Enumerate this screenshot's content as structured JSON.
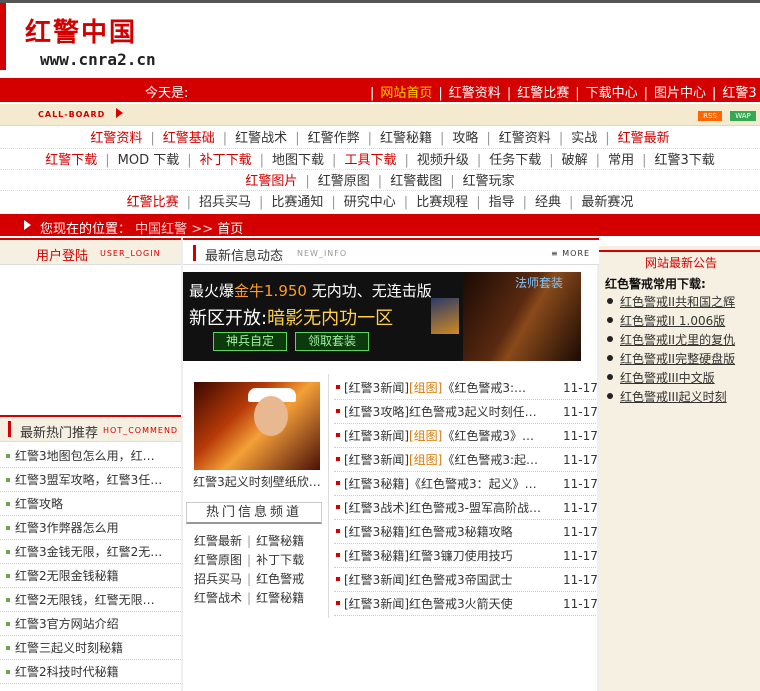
{
  "header": {
    "logo_title": "红警中国",
    "logo_url": "www.cnra2.cn"
  },
  "navbar": {
    "today_label": "今天是:",
    "items": [
      {
        "label": "网站首页",
        "active": true
      },
      {
        "label": "红警资料"
      },
      {
        "label": "红警比赛"
      },
      {
        "label": "下载中心"
      },
      {
        "label": "图片中心"
      },
      {
        "label": "红警3"
      }
    ]
  },
  "callboard": {
    "label": "CALL-BOARD",
    "rss": "RSS",
    "wap": "WAP"
  },
  "categories": {
    "row1": [
      "红警资料",
      "红警基础",
      "红警战术",
      "红警作弊",
      "红警秘籍",
      "攻略",
      "红警资料",
      "实战",
      "红警最新"
    ],
    "row1_red": [
      true,
      true,
      false,
      false,
      false,
      false,
      false,
      false,
      true
    ],
    "row2": [
      "红警下载",
      "MOD 下载",
      "补丁下载",
      "地图下载",
      "工具下载",
      "视频升级",
      "任务下载",
      "破解",
      "常用",
      "红警3下载"
    ],
    "row2_red": [
      true,
      false,
      true,
      false,
      true,
      false,
      false,
      false,
      false,
      false
    ],
    "row3": [
      "红警图片",
      "红警原图",
      "红警截图",
      "红警玩家"
    ],
    "row3_red": [
      true,
      false,
      false,
      false
    ],
    "row4": [
      "红警比赛",
      "招兵买马",
      "比赛通知",
      "研究中心",
      "比赛规程",
      "指导",
      "经典",
      "最新赛况"
    ],
    "row4_red": [
      true,
      false,
      false,
      false,
      false,
      false,
      false,
      false
    ]
  },
  "location": {
    "prefix": "您现在的位置：",
    "path1": "中国红警",
    "sep": ">>",
    "path2": "首页"
  },
  "left": {
    "login_title": "用户登陆",
    "login_en": "USER_LOGIN",
    "hot_title": "最新热门推荐",
    "hot_en": "HOT_COMMEND",
    "hot_items": [
      "红警3地图包怎么用，红…",
      "红警3盟军攻略，红警3任…",
      "红警攻略",
      "红警3作弊器怎么用",
      "红警3金钱无限，红警2无…",
      "红警2无限金钱秘籍",
      "红警2无限钱，红警无限…",
      "红警3官方网站介绍",
      "红警三起义时刻秘籍",
      "红警2科技时代秘籍"
    ]
  },
  "middle": {
    "title": "最新信息动态",
    "en": "NEW_INFO",
    "more": "MORE",
    "banner": {
      "line1_a": "最火爆",
      "line1_gold": "金牛1.950",
      "line1_b": " 无内功、无连击版",
      "line2_a": "新区开放:",
      "line2_gold": "暗影无内功一区",
      "btn1": "神兵自定",
      "btn2": "领取套装",
      "badge": "法师套装"
    },
    "photo_caption": "红警3起义时刻壁纸欣…",
    "channel_title": "热门信息频道",
    "channels": [
      [
        "红警最新",
        "红警秘籍"
      ],
      [
        "红警原图",
        "补丁下载"
      ],
      [
        "招兵买马",
        "红色警戒"
      ],
      [
        "红警战术",
        "红警秘籍"
      ]
    ],
    "news": [
      {
        "cat": "[红警3新闻]",
        "tag": "[组图]",
        "text": "《红色警戒3:…",
        "date": "11-17"
      },
      {
        "cat": "[红警3攻略]",
        "tag": "",
        "text": "红色警戒3起义时刻任…",
        "date": "11-17"
      },
      {
        "cat": "[红警3新闻]",
        "tag": "[组图]",
        "text": "《红色警戒3》…",
        "date": "11-17"
      },
      {
        "cat": "[红警3新闻]",
        "tag": "[组图]",
        "text": "《红色警戒3:起…",
        "date": "11-17"
      },
      {
        "cat": "[红警3秘籍]",
        "tag": "",
        "text": "《红色警戒3：起义》…",
        "date": "11-17"
      },
      {
        "cat": "[红警3战术]",
        "tag": "",
        "text": "红色警戒3-盟军高阶战…",
        "date": "11-17"
      },
      {
        "cat": "[红警3秘籍]",
        "tag": "",
        "text": "红色警戒3秘籍攻略",
        "date": "11-17"
      },
      {
        "cat": "[红警3秘籍]",
        "tag": "",
        "text": "红警3镰刀使用技巧",
        "date": "11-17"
      },
      {
        "cat": "[红警3新闻]",
        "tag": "",
        "text": "红色警戒3帝国武士",
        "date": "11-17"
      },
      {
        "cat": "[红警3新闻]",
        "tag": "",
        "text": "红色警戒3火箭天使",
        "date": "11-17"
      }
    ]
  },
  "right": {
    "title": "网站最新公告",
    "subtitle": "红色警戒常用下载:",
    "items": [
      "红色警戒II共和国之辉",
      "红色警戒II 1.006版",
      "红色警戒II尤里的复仇",
      "红色警戒II完整硬盘版",
      "红色警戒III中文版",
      "红色警戒III起义时刻"
    ]
  },
  "colors": {
    "brand_red": "#d40000",
    "cream": "#f6f0e2",
    "news_tag": "#d77a00"
  }
}
